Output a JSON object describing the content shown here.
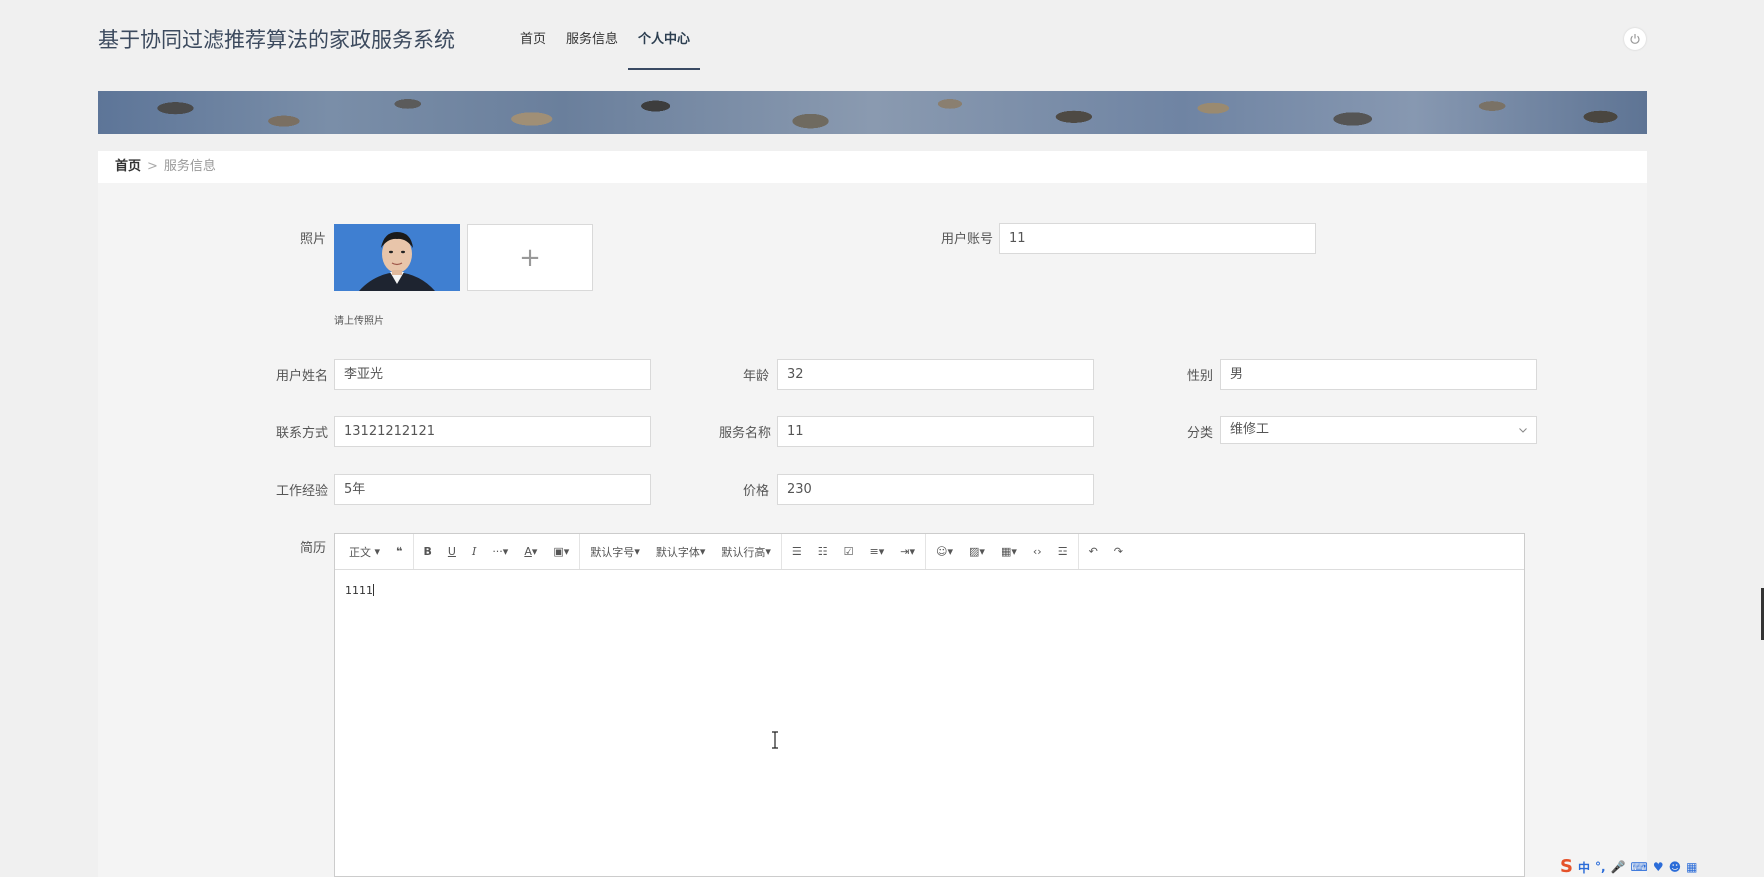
{
  "header": {
    "title": "基于协同过滤推荐算法的家政服务系统",
    "nav": [
      {
        "label": "首页",
        "active": false
      },
      {
        "label": "服务信息",
        "active": false
      },
      {
        "label": "个人中心",
        "active": true
      }
    ],
    "power_icon": "power-icon"
  },
  "breadcrumb": {
    "home": "首页",
    "separator": ">",
    "current": "服务信息"
  },
  "form": {
    "photo": {
      "label": "照片",
      "upload_hint": "请上传照片",
      "upload_plus": "+"
    },
    "account": {
      "label": "用户账号",
      "value": "11"
    },
    "name": {
      "label": "用户姓名",
      "value": "李亚光"
    },
    "age": {
      "label": "年龄",
      "value": "32"
    },
    "gender": {
      "label": "性别",
      "value": "男"
    },
    "contact": {
      "label": "联系方式",
      "value": "13121212121"
    },
    "service_name": {
      "label": "服务名称",
      "value": "11"
    },
    "category": {
      "label": "分类",
      "value": "维修工"
    },
    "experience": {
      "label": "工作经验",
      "value": "5年"
    },
    "price": {
      "label": "价格",
      "value": "230"
    },
    "resume": {
      "label": "简历",
      "content": "1111"
    }
  },
  "editor_toolbar": {
    "paragraph": "正文",
    "font_size": "默认字号",
    "font_family": "默认字体",
    "line_height": "默认行高"
  },
  "tray": {
    "ime_label": "中"
  },
  "colors": {
    "page_bg": "#f0f0f0",
    "nav_active_underline": "#3a4a63",
    "title": "#3c4a5e"
  }
}
